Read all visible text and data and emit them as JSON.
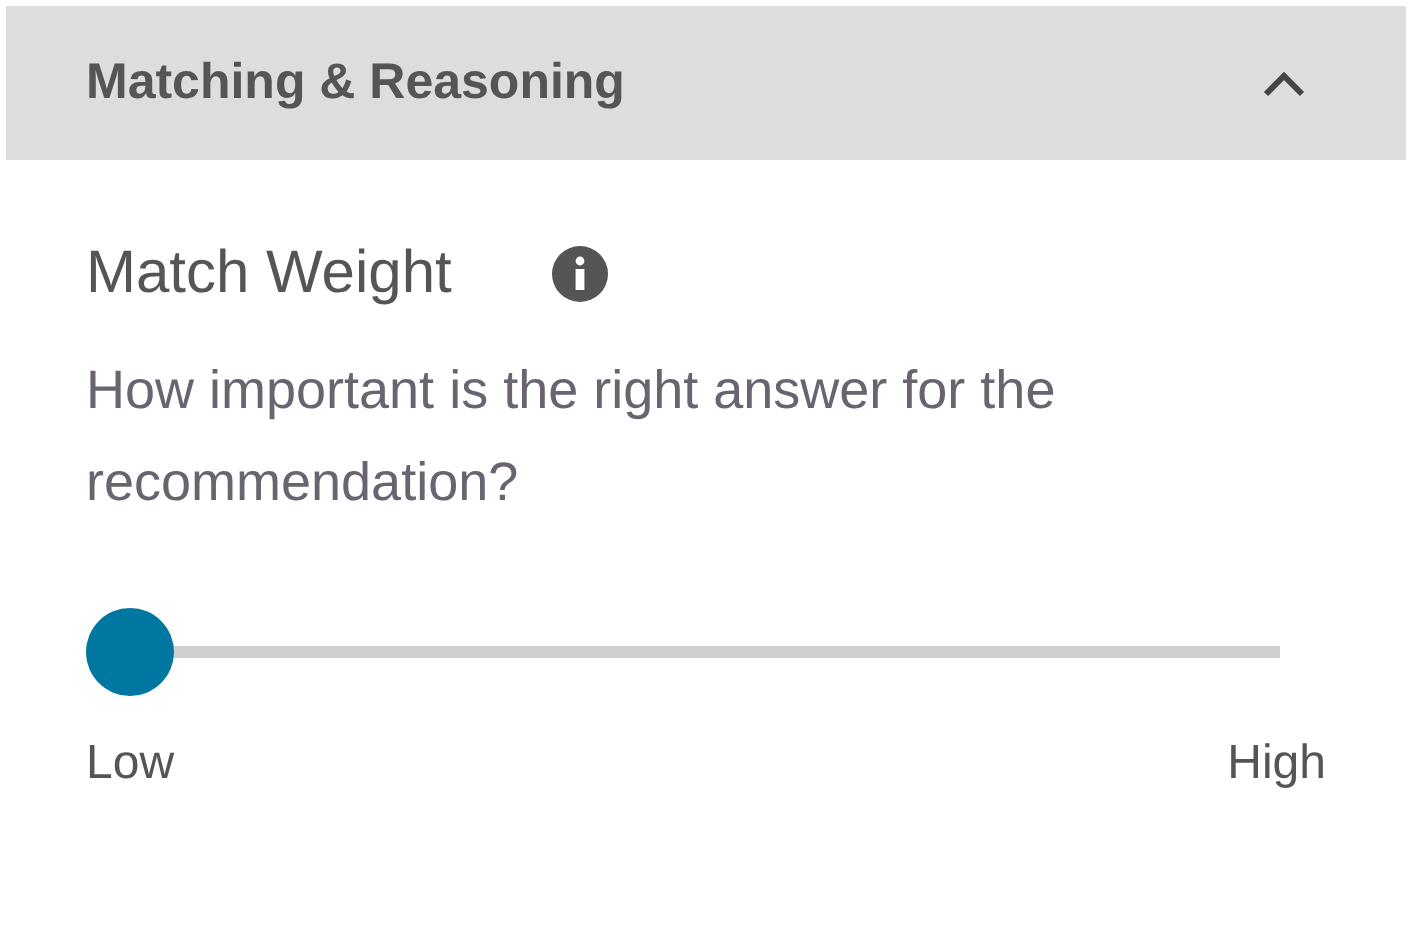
{
  "section": {
    "title": "Matching & Reasoning",
    "expanded": true
  },
  "field": {
    "label": "Match Weight",
    "question": "How important is the right answer for the recommendation?"
  },
  "slider": {
    "level": 0,
    "min_label": "Low",
    "max_label": "High"
  }
}
